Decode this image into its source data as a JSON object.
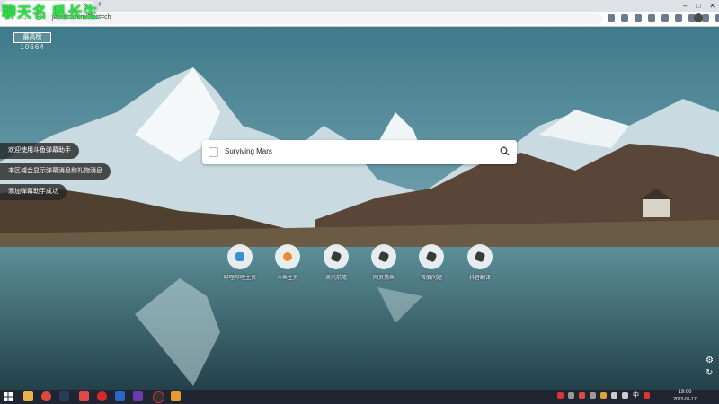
{
  "browser": {
    "tab_close": "×",
    "new_tab": "+",
    "url": "jianfast.com/?lest=ch",
    "window_controls": [
      "–",
      "□",
      "✕"
    ],
    "nav": [
      "←",
      "→",
      "C",
      "⌂"
    ]
  },
  "overlay": {
    "streamer_name": "聊天名 吼长生"
  },
  "room": {
    "label": "最高榜",
    "number": "10664"
  },
  "search": {
    "value": "Surviving Mars"
  },
  "notifications": [
    "欢迎使用斗鱼弹幕助手",
    "本区域会显示弹幕消息和礼物消息",
    "添加弹幕助手成功"
  ],
  "shortcuts": [
    {
      "label": "哔哩哔哩主页",
      "color": "#3a8fd6"
    },
    {
      "label": "斗鱼主页",
      "color": "#f08a28"
    },
    {
      "label": "蒸汽前瞻",
      "color": "#3a3a3a"
    },
    {
      "label": "网页捕鱼",
      "color": "#3a3a3a"
    },
    {
      "label": "百度问题",
      "color": "#3a3a3a"
    },
    {
      "label": "抖音翻译",
      "color": "#3a3a3a"
    }
  ],
  "taskbar": {
    "clock_time": "19:00",
    "clock_date": "2022-01-17",
    "lang": "中"
  },
  "colors": {
    "accent_green": "#26e63a",
    "taskbar": "#1f2531"
  }
}
